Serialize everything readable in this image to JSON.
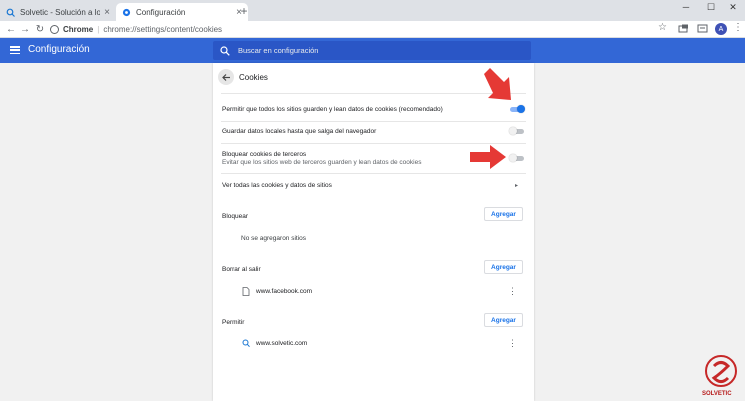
{
  "browser": {
    "tabs": [
      {
        "title": "Solvetic - Solución a los problem",
        "close": "×"
      },
      {
        "title": "Configuración",
        "close": "×"
      }
    ],
    "new_tab": "+",
    "window_controls": {
      "minimize": "─",
      "maximize": "☐",
      "close": "✕"
    },
    "nav": {
      "back": "←",
      "forward": "→",
      "reload": "↻"
    },
    "omnibox": {
      "protocol": "Chrome",
      "separator": "|",
      "url": "chrome://settings/content/cookies"
    },
    "bookmark": "☆",
    "profile_initial": "A",
    "menu": "⋮"
  },
  "header": {
    "title": "Configuración",
    "search_placeholder": "Buscar en configuración"
  },
  "page": {
    "title": "Cookies",
    "settings": [
      {
        "label": "Permitir que todos los sitios guarden y lean datos de cookies (recomendado)",
        "enabled": true
      },
      {
        "label": "Guardar datos locales hasta que salga del navegador",
        "enabled": false
      },
      {
        "label": "Bloquear cookies de terceros",
        "sublabel": "Evitar que los sitios web de terceros guarden y lean datos de cookies",
        "enabled": false
      }
    ],
    "see_all": {
      "label": "Ver todas las cookies y datos de sitios",
      "chevron": "▸"
    },
    "block": {
      "label": "Bloquear",
      "add": "Agregar",
      "empty": "No se agregaron sitios"
    },
    "clear_on_exit": {
      "label": "Borrar al salir",
      "add": "Agregar",
      "sites": [
        "www.facebook.com"
      ]
    },
    "allow": {
      "label": "Permitir",
      "add": "Agregar",
      "sites": [
        "www.solvetic.com"
      ]
    },
    "more": "⋮"
  },
  "watermark": {
    "text": "SOLVETIC"
  },
  "colors": {
    "header": "#3367d6",
    "accent": "#1a73e8",
    "arrow": "#e53935"
  },
  "icons": [
    "hamburger-icon",
    "search-icon",
    "back-arrow-icon",
    "file-icon",
    "magnifier-icon",
    "more-vert-icon"
  ]
}
